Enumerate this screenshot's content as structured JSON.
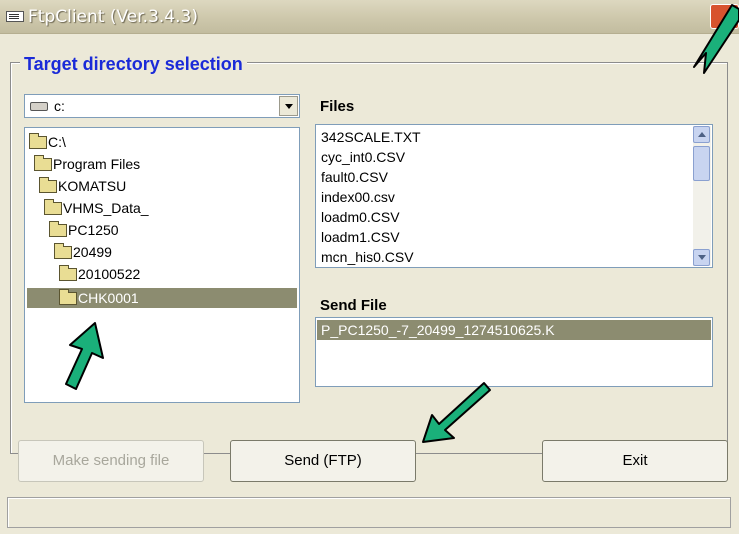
{
  "window": {
    "title": "FtpClient (Ver.3.4.3)",
    "icon": "app-window-icon"
  },
  "group": {
    "label": "Target directory selection"
  },
  "drive": {
    "selected": "c:",
    "icon": "drive-icon"
  },
  "tree": {
    "items": [
      {
        "label": "C:\\"
      },
      {
        "label": "Program Files"
      },
      {
        "label": "KOMATSU"
      },
      {
        "label": "VHMS_Data_"
      },
      {
        "label": "PC1250"
      },
      {
        "label": "20499"
      },
      {
        "label": "20100522"
      },
      {
        "label": "CHK0001",
        "selected": true
      }
    ]
  },
  "files": {
    "label": "Files",
    "items": [
      "342SCALE.TXT",
      "cyc_int0.CSV",
      "fault0.CSV",
      "index00.csv",
      "loadm0.CSV",
      "loadm1.CSV",
      "mcn_his0.CSV"
    ]
  },
  "send_file": {
    "label": "Send File",
    "items": [
      "P_PC1250_-7_20499_1274510625.K"
    ]
  },
  "buttons": {
    "make": "Make sending file",
    "send": "Send  (FTP)",
    "exit": "Exit"
  },
  "colors": {
    "group_label": "#1a2ad8",
    "selection": "#8c8c70",
    "annotation_arrow": "#1ab07a"
  }
}
